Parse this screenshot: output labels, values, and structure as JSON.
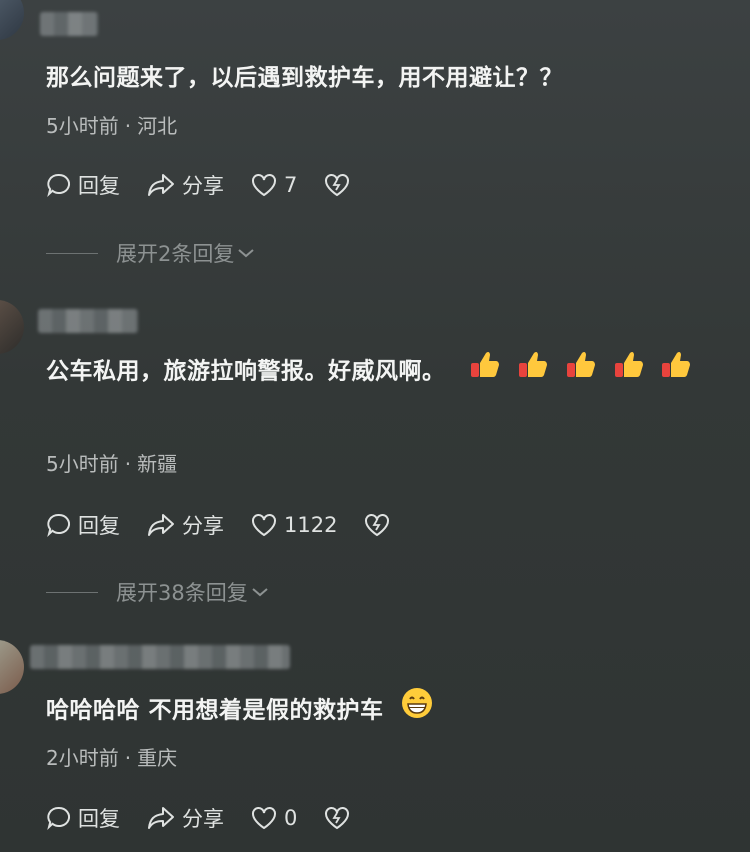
{
  "comments": [
    {
      "text": "那么问题来了，以后遇到救护车，用不用避让？？",
      "time": "5小时前",
      "location": "河北",
      "reply_label": "回复",
      "share_label": "分享",
      "likes": "7",
      "expand": "展开2条回复"
    },
    {
      "text": "公车私用，旅游拉响警报。好威风啊。",
      "time": "5小时前",
      "location": "新疆",
      "reply_label": "回复",
      "share_label": "分享",
      "likes": "1122",
      "expand": "展开38条回复"
    },
    {
      "text": "哈哈哈哈 不用想着是假的救护车",
      "time": "2小时前",
      "location": "重庆",
      "reply_label": "回复",
      "share_label": "分享",
      "likes": "0"
    }
  ],
  "separator": "·",
  "icons": [
    "reply-icon",
    "share-icon",
    "like-icon",
    "dislike-icon",
    "thumbs-up-emoji",
    "grin-emoji"
  ]
}
